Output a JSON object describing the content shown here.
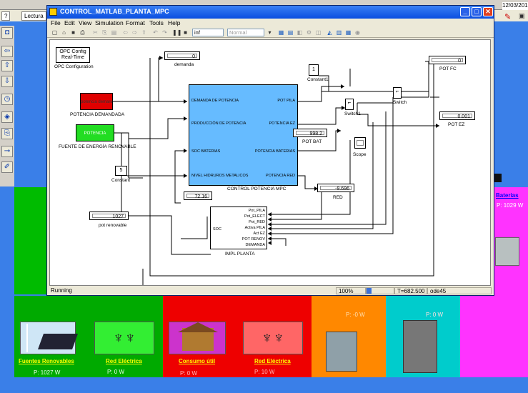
{
  "background": {
    "tabs": [
      "?",
      "Lectura"
    ],
    "date": "12/03/2012",
    "right_label": "Baterias",
    "right_power": "P:  1029  W"
  },
  "panels": {
    "renewables": {
      "label": "Fuentes Renovables",
      "power": "P:  1027  W"
    },
    "grid1": {
      "label": "Red Eléctrica",
      "power": "P:    0   W"
    },
    "consumption": {
      "label": "Consumo útil",
      "power": "P:    0   W"
    },
    "grid2": {
      "label": "Red Eléctrica",
      "power": "P:   10   W"
    },
    "electrolyzer": {
      "power": "P:   -0   W"
    },
    "fuelcell": {
      "power": "P:    0   W"
    }
  },
  "window": {
    "title": "CONTROL_MATLAB_PLANTA_MPC",
    "menus": [
      "File",
      "Edit",
      "View",
      "Simulation",
      "Format",
      "Tools",
      "Help"
    ],
    "sim_time": "inf",
    "sim_mode": "Normal",
    "status": "Running",
    "zoom": "100%",
    "time": "T=682.500",
    "solver": "ode45"
  },
  "diagram": {
    "opc_config": {
      "line1": "OPC Config",
      "line2": "Real-Time",
      "caption": "OPC Configuration"
    },
    "demanda": {
      "value": "0",
      "caption": "demanda"
    },
    "potencia_demandada": {
      "text": "potencia demandada",
      "caption": "POTENCIA DEMANDADA"
    },
    "potencia_salida": {
      "text": "POTENCIA SALIDA",
      "caption": "FUENTE DE ENERGÍA RENOVABLE"
    },
    "constant": {
      "value": "5",
      "caption": "Constant"
    },
    "constant1": {
      "value": "1",
      "caption": "Constant1"
    },
    "pot_renovable": {
      "value": "1027",
      "caption": "pot renovable"
    },
    "soc": {
      "value": "72.16"
    },
    "control": {
      "caption": "CONTROL POTENCIA MPC",
      "inputs": [
        "DEMANDA DE POTENCIA",
        "PRODUCCIÓN DE POTENCIA",
        "SOC BATERIAS",
        "NIVEL HIDRUROS METALICOS"
      ],
      "outputs": [
        "POT PILA",
        "POTENCIA EZ",
        "POTENCIA BATERIAS",
        "POTENCIA RED"
      ]
    },
    "pot_fc": {
      "value": "0",
      "caption": "POT FC"
    },
    "pot_ez": {
      "value": "0.001",
      "caption": "POT EZ"
    },
    "pot_bat": {
      "value": "998.2",
      "caption": "POT BAT"
    },
    "red": {
      "value": "-9.696",
      "caption": "RED"
    },
    "scope": {
      "caption": "Scope"
    },
    "switch": {
      "caption": "Switch"
    },
    "switch1": {
      "caption": "Switch1"
    },
    "planta": {
      "caption": "IMPL PLANTA",
      "soc_port": "SOC",
      "inputs": [
        "Pot_PILA",
        "Pot_ELECT",
        "Pot_RED",
        "Activa PILA",
        "Act EZ",
        "POT RENOV",
        "DEMANDA"
      ]
    }
  },
  "colors": {
    "desktop": "#3a7fe8",
    "red_block": "#e00000",
    "green_block": "#22dd22",
    "control_block": "#66bbff"
  }
}
